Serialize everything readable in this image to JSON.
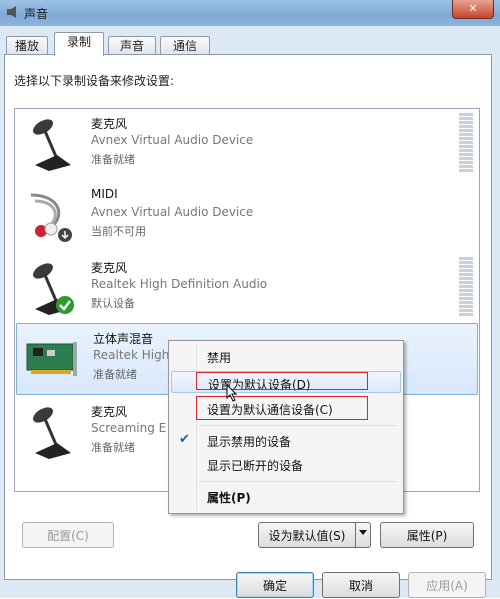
{
  "window": {
    "title": "声音",
    "close_label": "✕"
  },
  "tabs": [
    {
      "label": "播放",
      "active": false
    },
    {
      "label": "录制",
      "active": true
    },
    {
      "label": "声音",
      "active": false
    },
    {
      "label": "通信",
      "active": false
    }
  ],
  "instruction": "选择以下录制设备来修改设置:",
  "devices": [
    {
      "name": "麦克风",
      "description": "Avnex Virtual Audio Device",
      "status": "准备就绪",
      "icon": "microphone-icon"
    },
    {
      "name": "MIDI",
      "description": "Avnex Virtual Audio Device",
      "status": "当前不可用",
      "icon": "midi-cable-icon"
    },
    {
      "name": "麦克风",
      "description": "Realtek High Definition Audio",
      "status": "默认设备",
      "icon": "microphone-icon",
      "default_badge": "check-badge-icon"
    },
    {
      "name": "立体声混音",
      "description": "Realtek High",
      "status": "准备就绪",
      "icon": "sound-card-icon",
      "selected": true
    },
    {
      "name": "麦克风",
      "description": "Screaming E",
      "status": "准备就绪",
      "icon": "microphone-icon"
    }
  ],
  "context_menu": {
    "items": [
      {
        "label": "禁用"
      },
      {
        "label": "设置为默认设备(D)"
      },
      {
        "label": "设置为默认通信设备(C)"
      },
      {
        "label": "显示禁用的设备",
        "checked": true
      },
      {
        "label": "显示已断开的设备"
      },
      {
        "label": "属性(P)"
      }
    ]
  },
  "buttons": {
    "configure": "配置(C)",
    "set_default": "设为默认值(S)",
    "properties": "属性(P)",
    "ok": "确定",
    "cancel": "取消",
    "apply": "应用(A)"
  },
  "colors": {
    "accent": "#84acdd",
    "highlight_box": "#d8262a"
  }
}
